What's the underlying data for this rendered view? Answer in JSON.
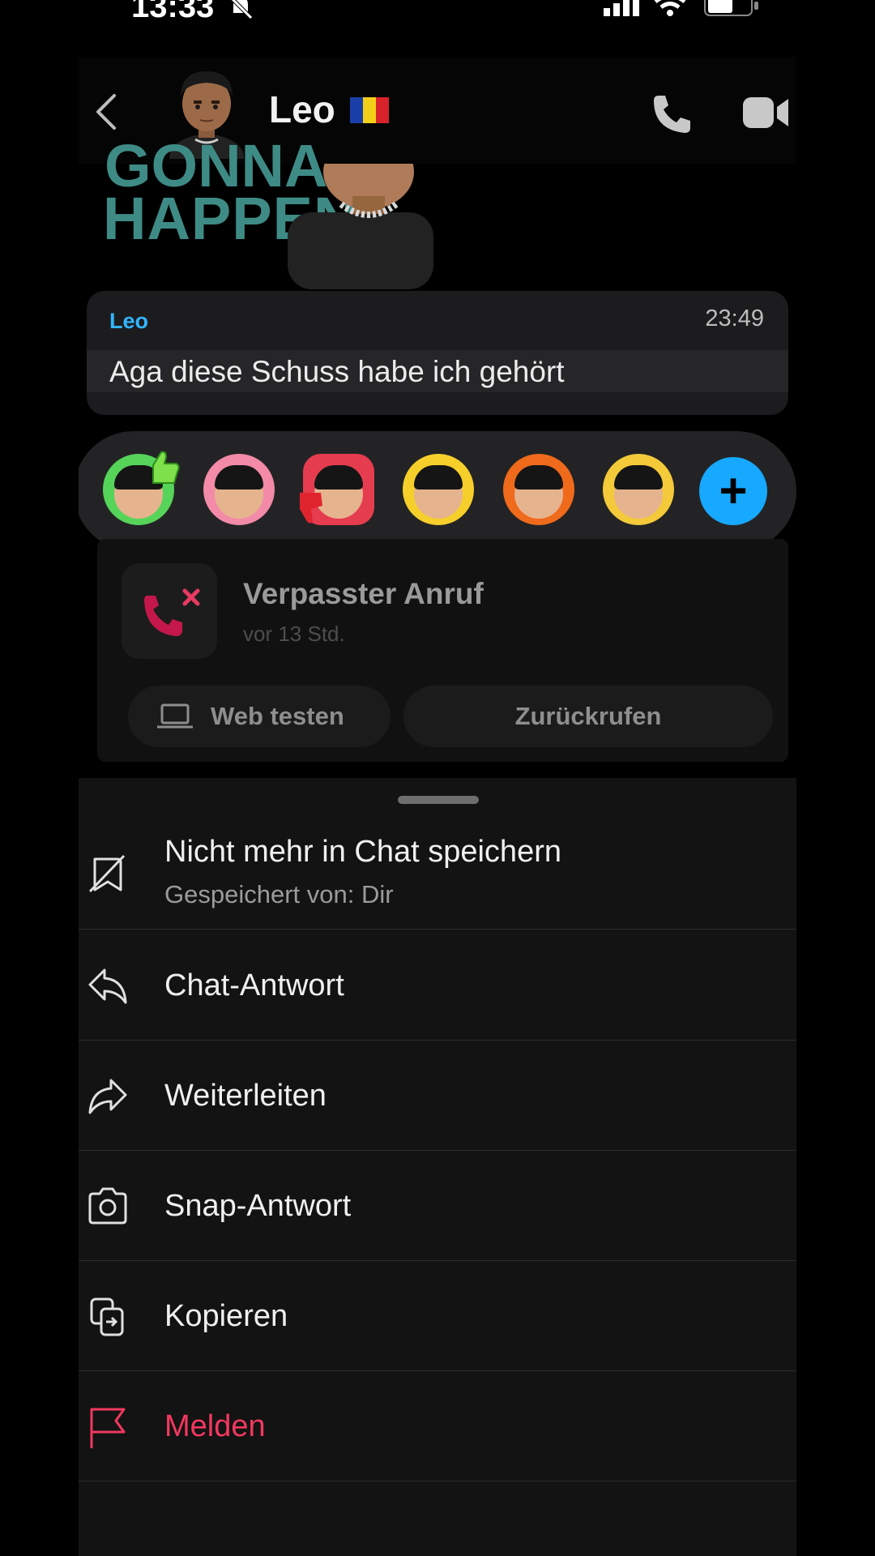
{
  "status_bar": {
    "time": "13:33"
  },
  "header": {
    "contact_name": "Leo",
    "flag_colors": [
      "#1a3fa8",
      "#f4cf19",
      "#d8232a"
    ]
  },
  "sticker": {
    "text_line1": "GONNA",
    "text_line2": "HAPPEN"
  },
  "message": {
    "sender": "Leo",
    "time": "23:49",
    "text": "Aga diese Schuss habe ich gehört",
    "sender_color": "#33b4ff"
  },
  "reactions": {
    "items": [
      {
        "name": "thumbs-up",
        "ring": "#56d45a"
      },
      {
        "name": "heart",
        "ring": "#f28aa8"
      },
      {
        "name": "thumbs-down",
        "ring": "#e63c4f"
      },
      {
        "name": "laugh-cry",
        "ring": "#f6cf2b"
      },
      {
        "name": "fire",
        "ring": "#f06a1c"
      },
      {
        "name": "sad",
        "ring": "#f4c93a"
      }
    ],
    "add_color": "#17a9ff"
  },
  "missed_call": {
    "title": "Verpasster Anruf",
    "subtitle": "vor 13 Std.",
    "web_button": "Web testen",
    "callback_button": "Zurückrufen"
  },
  "menu": {
    "items": [
      {
        "label": "Nicht mehr in Chat speichern",
        "sublabel": "Gespeichert von: Dir",
        "icon": "unsave-icon"
      },
      {
        "label": "Chat-Antwort",
        "icon": "reply-icon"
      },
      {
        "label": "Weiterleiten",
        "icon": "forward-icon"
      },
      {
        "label": "Snap-Antwort",
        "icon": "camera-icon"
      },
      {
        "label": "Kopieren",
        "icon": "copy-icon"
      },
      {
        "label": "Melden",
        "icon": "flag-icon",
        "color": "#f2385f"
      }
    ]
  }
}
